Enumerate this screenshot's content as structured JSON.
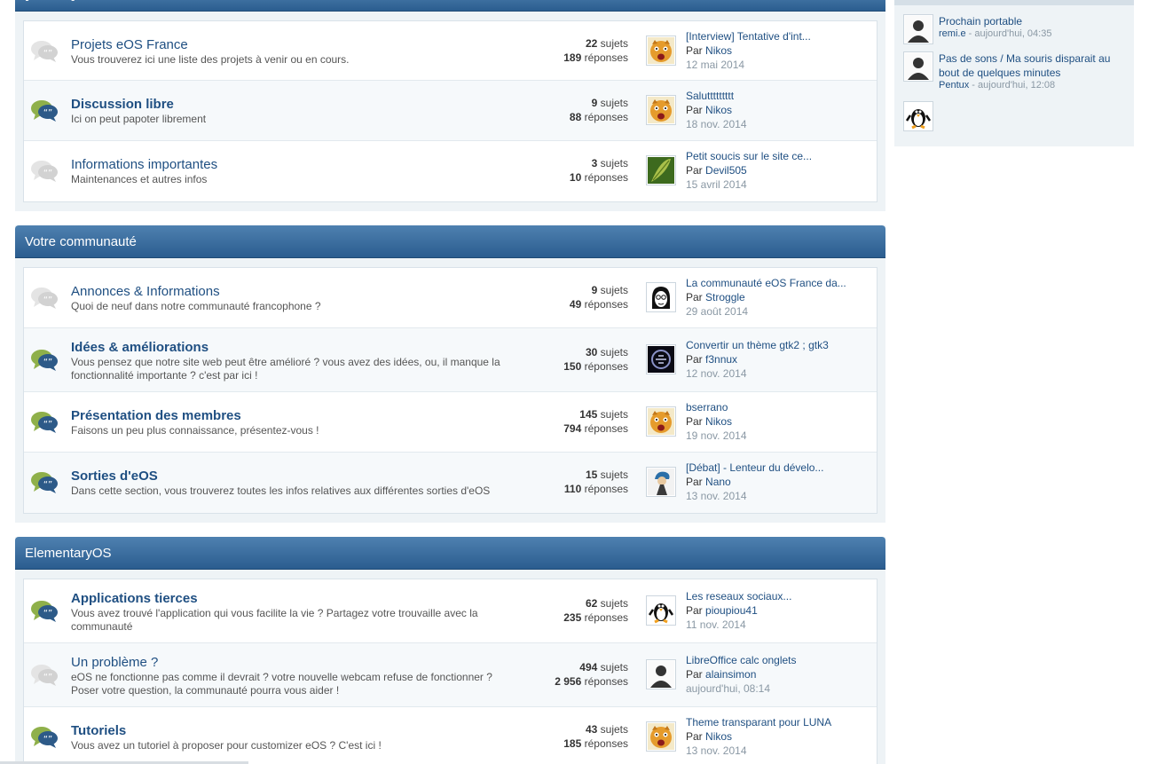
{
  "categories": [
    {
      "title": "[ADMIN] Le coin des admins d'eOS France",
      "forums": [
        {
          "title": "Projets eOS France",
          "bold": false,
          "read": true,
          "desc": "Vous trouverez ici une liste des projets à venir ou en cours.",
          "topics": "22",
          "posts": "189",
          "last_title": "[Interview] Tentative d'int...",
          "last_by": "Nikos",
          "last_date": "12 mai 2014",
          "avatar": "tiger-avatar"
        },
        {
          "title": "Discussion libre",
          "bold": true,
          "read": false,
          "desc": "Ici on peut papoter librement",
          "topics": "9",
          "posts": "88",
          "last_title": "Saluttttttttt",
          "last_by": "Nikos",
          "last_date": "18 nov. 2014",
          "avatar": "tiger-avatar"
        },
        {
          "title": "Informations importantes",
          "bold": false,
          "read": true,
          "desc": "Maintenances et autres infos",
          "topics": "3",
          "posts": "10",
          "last_title": "Petit soucis sur le site ce...",
          "last_by": "Devil505",
          "last_date": "15 avril 2014",
          "avatar": "leaf-avatar"
        }
      ]
    },
    {
      "title": "Votre communauté",
      "forums": [
        {
          "title": "Annonces & Informations",
          "bold": false,
          "read": true,
          "desc": "Quoi de neuf dans notre communauté francophone ?",
          "topics": "9",
          "posts": "49",
          "last_title": "La communauté eOS France da...",
          "last_by": "Stroggle",
          "last_date": "29 août 2014",
          "avatar": "face-avatar"
        },
        {
          "title": "Idées & améliorations",
          "bold": true,
          "read": false,
          "desc": "Vous pensez que notre site web peut être amélioré ? vous avez des idées, ou, il manque la fonctionnalité importante ? c'est par ici !",
          "topics": "30",
          "posts": "150",
          "last_title": "Convertir un thème gtk2 ; gtk3",
          "last_by": "f3nnux",
          "last_date": "12 nov. 2014",
          "avatar": "logo-avatar"
        },
        {
          "title": "Présentation des membres",
          "bold": true,
          "read": false,
          "desc": "Faisons un peu plus connaissance, présentez-vous !",
          "topics": "145",
          "posts": "794",
          "last_title": "bserrano",
          "last_by": "Nikos",
          "last_date": "19 nov. 2014",
          "avatar": "tiger-avatar"
        },
        {
          "title": "Sorties d'eOS",
          "bold": true,
          "read": false,
          "desc": "Dans cette section, vous trouverez toutes les infos relatives aux différentes sorties d'eOS",
          "topics": "15",
          "posts": "110",
          "last_title": "[Débat] - Lenteur du dévelo...",
          "last_by": "Nano",
          "last_date": "13 nov. 2014",
          "avatar": "character-avatar"
        }
      ]
    },
    {
      "title": "ElementaryOS",
      "forums": [
        {
          "title": "Applications tierces",
          "bold": true,
          "read": false,
          "desc": "Vous avez trouvé l'application qui vous facilite la vie ? Partagez votre trouvaille avec la communauté",
          "topics": "62",
          "posts": "235",
          "last_title": "Les reseaux sociaux...",
          "last_by": "pioupiou41",
          "last_date": "11 nov. 2014",
          "avatar": "penguin-avatar"
        },
        {
          "title": "Un problème ?",
          "bold": false,
          "read": true,
          "desc": "eOS ne fonctionne pas comme il devrait ? votre nouvelle webcam refuse de fonctionner ? Poser votre question, la communauté pourra vous aider !",
          "topics": "494",
          "posts": "2 956",
          "last_title": "LibreOffice calc onglets",
          "last_by": "alainsimon",
          "last_date": "aujourd'hui, 08:14",
          "avatar": "default-avatar"
        },
        {
          "title": "Tutoriels",
          "bold": true,
          "read": false,
          "desc": "Vous avez un tutoriel à proposer pour customizer eOS ? C'est ici !",
          "topics": "43",
          "posts": "185",
          "last_title": "Theme transparant pour LUNA",
          "last_by": "Nikos",
          "last_date": "13 nov. 2014",
          "avatar": "tiger-avatar"
        }
      ]
    }
  ],
  "labels": {
    "topics": "sujets",
    "posts": "réponses",
    "by": "Par"
  },
  "sidebar": [
    {
      "title": "Prochain portable",
      "user": "remi.e",
      "time": "aujourd'hui, 04:35",
      "avatar": "default-avatar"
    },
    {
      "title": "Pas de sons / Ma souris disparait au bout de quelques minutes",
      "user": "Pentux",
      "time": "aujourd'hui, 12:08",
      "avatar": "default-avatar"
    },
    {
      "title": "",
      "user": "",
      "time": "",
      "avatar": "penguin-avatar"
    }
  ],
  "colors": {
    "header": "#2b5d8f",
    "link": "#1f4f82",
    "unread_icon": "#2d5a88",
    "unread_quote": "#8fb04a"
  }
}
